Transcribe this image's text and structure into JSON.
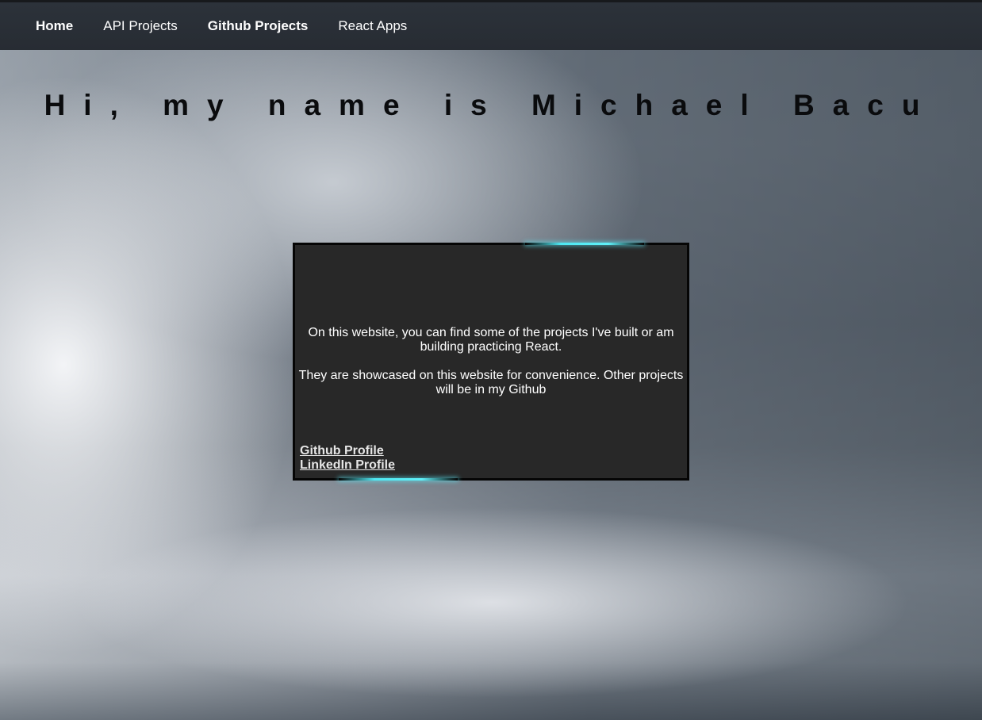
{
  "nav": {
    "items": [
      {
        "label": "Home"
      },
      {
        "label": "API Projects"
      },
      {
        "label": "Github Projects"
      },
      {
        "label": "React Apps"
      }
    ]
  },
  "hero": {
    "title": "Hi, my name is Michael Bacu"
  },
  "card": {
    "paragraph1": "On this website, you can find some of the projects I've built or am building practicing React.",
    "paragraph2": "They are showcased on this website for convenience. Other projects will be in my Github",
    "links": [
      {
        "label": "Github Profile"
      },
      {
        "label": "LinkedIn Profile"
      }
    ]
  },
  "colors": {
    "nav_background": "#2a3038",
    "card_background": "#282828",
    "accent_glow": "#4ee8f2"
  }
}
